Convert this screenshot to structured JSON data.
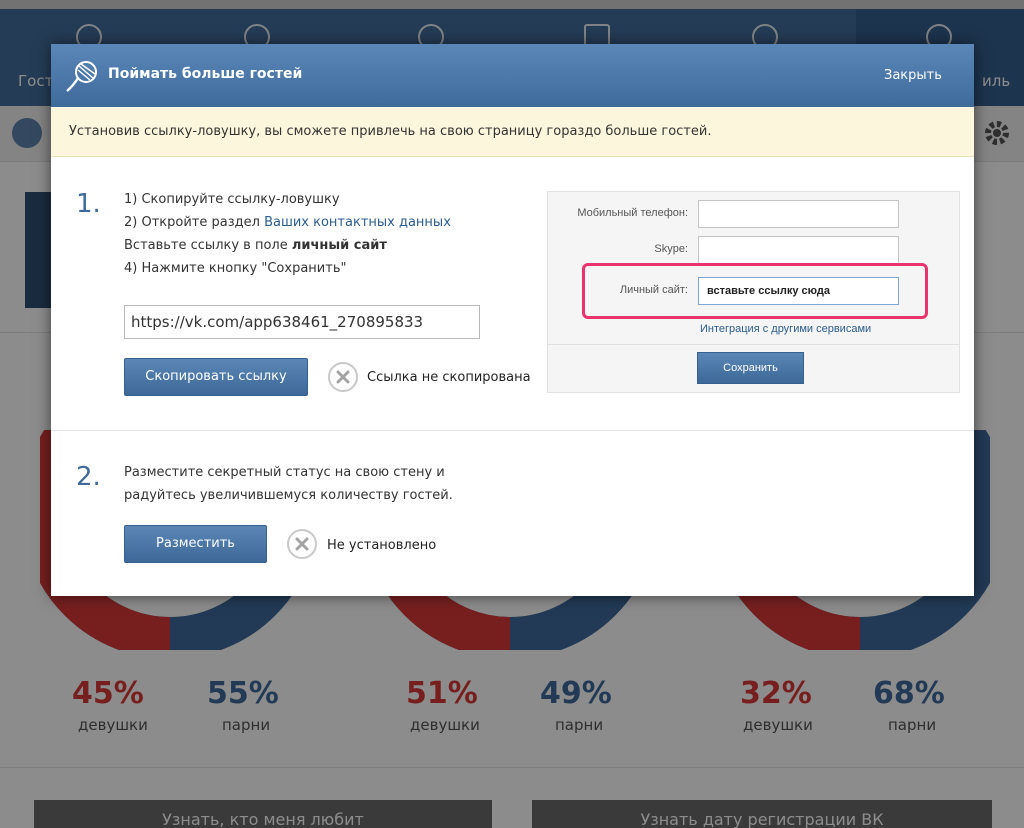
{
  "background": {
    "nav_left_label": "Гост",
    "nav_right_label": "иль",
    "pies": [
      {
        "girls_percent": "45%",
        "boys_percent": "55%",
        "girls_label": "девушки",
        "boys_label": "парни"
      },
      {
        "girls_percent": "51%",
        "boys_percent": "49%",
        "girls_label": "девушки",
        "boys_label": "парни"
      },
      {
        "girls_percent": "32%",
        "boys_percent": "68%",
        "girls_label": "девушки",
        "boys_label": "парни"
      }
    ],
    "button_left": "Узнать, кто меня любит",
    "button_right": "Узнать дату регистрации ВК",
    "colors": {
      "girls": "#d93a3a",
      "boys": "#3e6b9b"
    }
  },
  "modal": {
    "title": "Поймать больше гостей",
    "close_label": "Закрыть",
    "notice": "Установив ссылку-ловушку, вы сможете привлечь на свою страницу гораздо больше гостей.",
    "step1": {
      "number": "1.",
      "line1": "1) Скопируйте ссылку-ловушку",
      "line2_prefix": "2) Откройте раздел ",
      "line2_link": "Ваших контактных данных",
      "line3_prefix": "Вставьте ссылку в поле ",
      "line3_bold": "личный сайт",
      "line4": "4) Нажмите кнопку \"Сохранить\"",
      "link_value": "https://vk.com/app638461_270895833",
      "copy_button": "Скопировать ссылку",
      "status": "Ссылка не скопирована"
    },
    "preview": {
      "mobile_label": "Мобильный телефон:",
      "skype_label": "Skype:",
      "site_label": "Личный сайт:",
      "site_value": "вставьте ссылку сюда",
      "integration_link": "Интеграция с другими сервисами",
      "save_button": "Сохранить"
    },
    "step2": {
      "number": "2.",
      "line1": "Разместите секретный статус на свою стену и",
      "line2": "радуйтесь увеличившемуся количеству гостей.",
      "post_button": "Разместить",
      "status": "Не установлено"
    }
  }
}
